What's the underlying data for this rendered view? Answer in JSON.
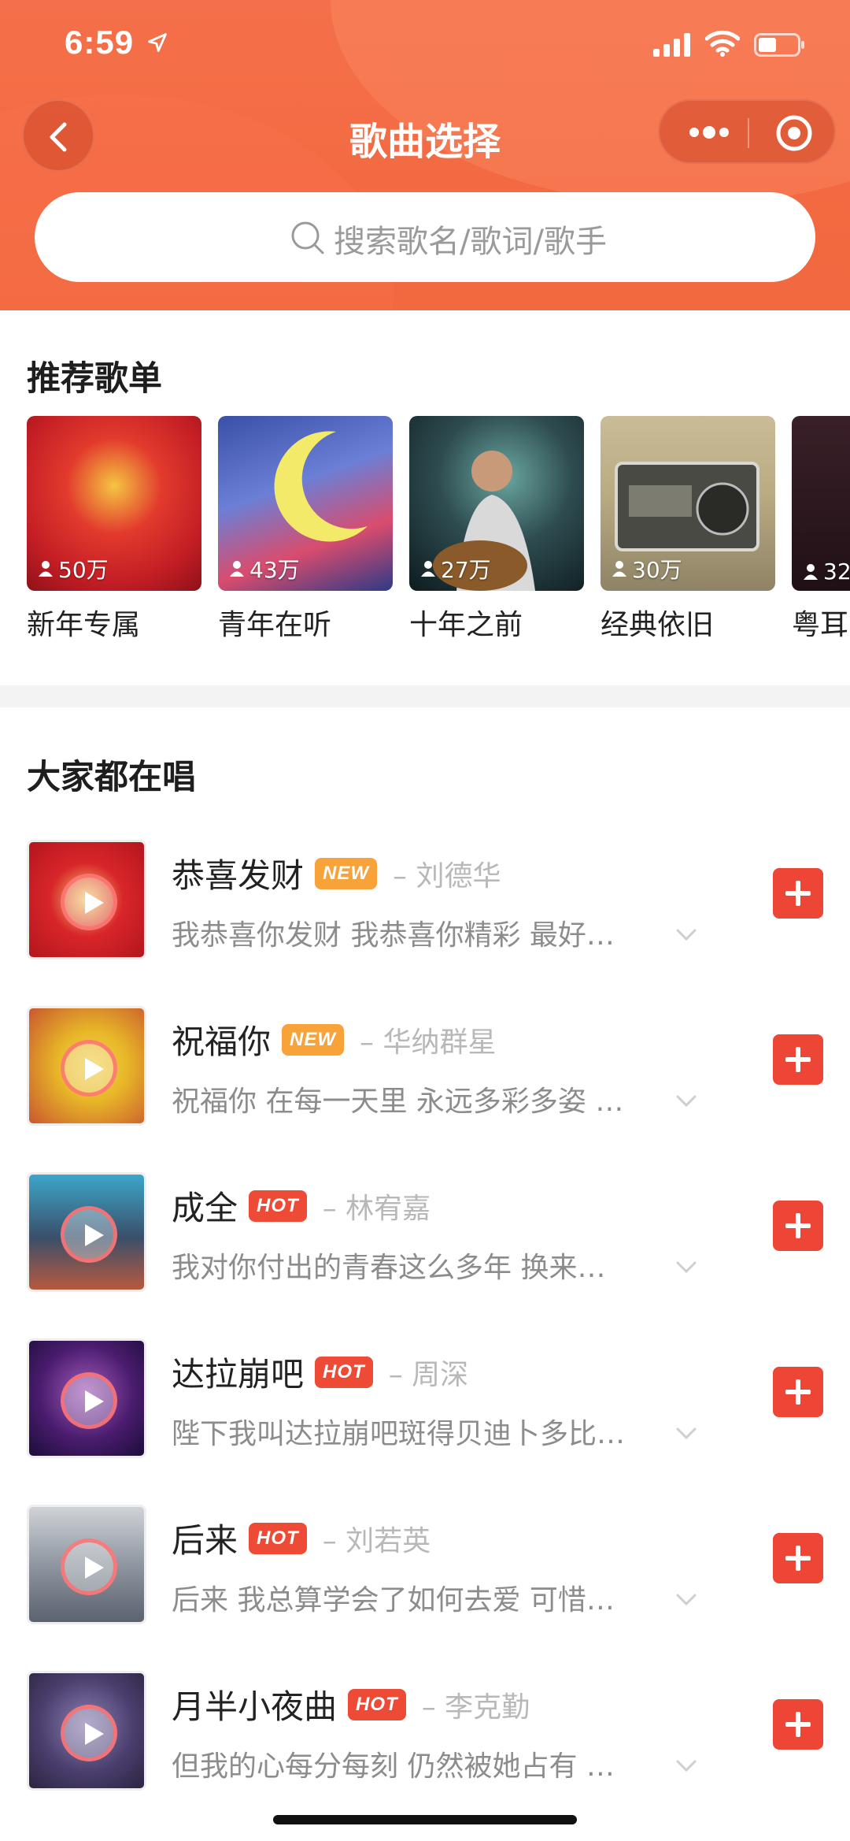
{
  "status_bar": {
    "time": "6:59"
  },
  "nav": {
    "title": "歌曲选择"
  },
  "search": {
    "placeholder": "搜索歌名/歌词/歌手"
  },
  "recommended": {
    "title": "推荐歌单",
    "playlists": [
      {
        "name": "新年专属",
        "listeners": "50万"
      },
      {
        "name": "青年在听",
        "listeners": "43万"
      },
      {
        "name": "十年之前",
        "listeners": "27万"
      },
      {
        "name": "经典依旧",
        "listeners": "30万"
      },
      {
        "name": "粤耳",
        "listeners": "32"
      }
    ]
  },
  "popular": {
    "title": "大家都在唱",
    "songs": [
      {
        "title": "恭喜发财",
        "badge": "NEW",
        "artist": "– 刘德华",
        "lyric": "我恭喜你发财 我恭喜你精彩 最好…"
      },
      {
        "title": "祝福你",
        "badge": "NEW",
        "artist": "– 华纳群星",
        "lyric": "祝福你 在每一天里 永远多彩多姿 …"
      },
      {
        "title": "成全",
        "badge": "HOT",
        "artist": "– 林宥嘉",
        "lyric": "我对你付出的青春这么多年 换来…"
      },
      {
        "title": "达拉崩吧",
        "badge": "HOT",
        "artist": "– 周深",
        "lyric": "陛下我叫达拉崩吧斑得贝迪卜多比…"
      },
      {
        "title": "后来",
        "badge": "HOT",
        "artist": "– 刘若英",
        "lyric": "后来 我总算学会了如何去爱 可惜…"
      },
      {
        "title": "月半小夜曲",
        "badge": "HOT",
        "artist": "– 李克勤",
        "lyric": "但我的心每分每刻 仍然被她占有 …"
      }
    ]
  },
  "colors": {
    "accent": "#f36a42",
    "add_button": "#ee4636",
    "badge_new": "#f8a23a",
    "badge_hot": "#ee4b36"
  }
}
